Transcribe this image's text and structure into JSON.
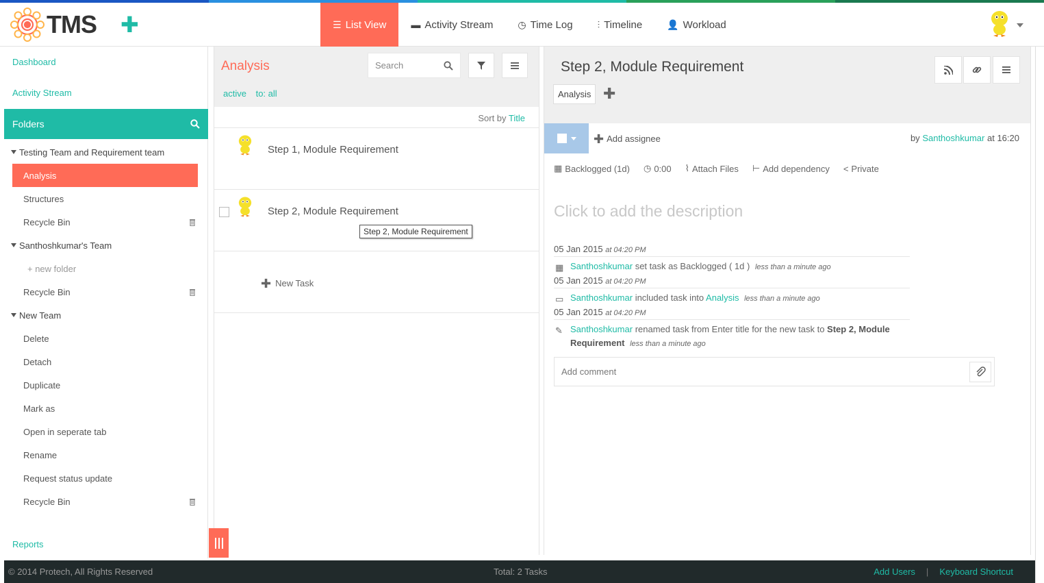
{
  "app": {
    "logo_text": "TMS"
  },
  "colors": {
    "accent": "#ff6b57",
    "teal": "#1fbba6",
    "stripe": [
      "#1a57c3",
      "#2a90e0",
      "#1fbba6",
      "#2aa05a",
      "#1a7a50"
    ]
  },
  "nav": [
    {
      "label": "List View",
      "icon": "list-icon"
    },
    {
      "label": "Activity Stream",
      "icon": "comment-icon"
    },
    {
      "label": "Time Log",
      "icon": "clock-icon"
    },
    {
      "label": "Timeline",
      "icon": "timeline-icon"
    },
    {
      "label": "Workload",
      "icon": "user-icon"
    }
  ],
  "sidebar": {
    "dashboard": "Dashboard",
    "activity_stream": "Activity Stream",
    "folders": "Folders",
    "reports": "Reports",
    "teams": [
      {
        "name": "Testing Team and Requirement team",
        "items": [
          "Analysis",
          "Structures",
          "Recycle Bin"
        ]
      },
      {
        "name": "Santhoshkumar's Team",
        "items": [
          "+ new folder",
          "Recycle Bin"
        ]
      },
      {
        "name": "New Team",
        "items": [
          "Delete",
          "Detach",
          "Duplicate",
          "Mark as",
          "Open in seperate tab",
          "Rename",
          "Request status update",
          "Recycle Bin"
        ]
      }
    ]
  },
  "list": {
    "title": "Analysis",
    "search_placeholder": "Search",
    "filter_active": "active",
    "filter_to": "to: all",
    "sort_prefix": "Sort by",
    "sort_field": "Title",
    "tasks": [
      "Step 1, Module Requirement",
      "Step 2, Module Requirement"
    ],
    "tooltip": "Step 2, Module Requirement",
    "new_task": "New Task"
  },
  "detail": {
    "title": "Step 2, Module Requirement",
    "tag": "Analysis",
    "add_assignee": "Add assignee",
    "by_prefix": "by",
    "by_user": "Santhoshkumar",
    "by_time": "at 16:20",
    "meta": {
      "status": "Backlogged (1d)",
      "time": "0:00",
      "attach": "Attach Files",
      "dependency": "Add dependency",
      "privacy": "Private"
    },
    "description_placeholder": "Click to add the description",
    "activities": [
      {
        "date": "05 Jan 2015",
        "time": "at 04:20 PM",
        "user": "Santhoshkumar",
        "text": "set task as Backlogged ( 1d )",
        "ago": "less than a minute ago"
      },
      {
        "date": "05 Jan 2015",
        "time": "at 04:20 PM",
        "user": "Santhoshkumar",
        "text": "included task into",
        "link": "Analysis",
        "ago": "less than a minute ago"
      },
      {
        "date": "05 Jan 2015",
        "time": "at 04:20 PM",
        "user": "Santhoshkumar",
        "text": "renamed task from Enter title for the new task to",
        "bold": "Step 2, Module Requirement",
        "ago": "less than a minute ago"
      }
    ],
    "comment_placeholder": "Add comment"
  },
  "footer": {
    "copyright": "© 2014 Protech, All Rights Reserved",
    "total": "Total: 2 Tasks",
    "add_users": "Add Users",
    "separator": "|",
    "keyboard": "Keyboard Shortcut"
  }
}
